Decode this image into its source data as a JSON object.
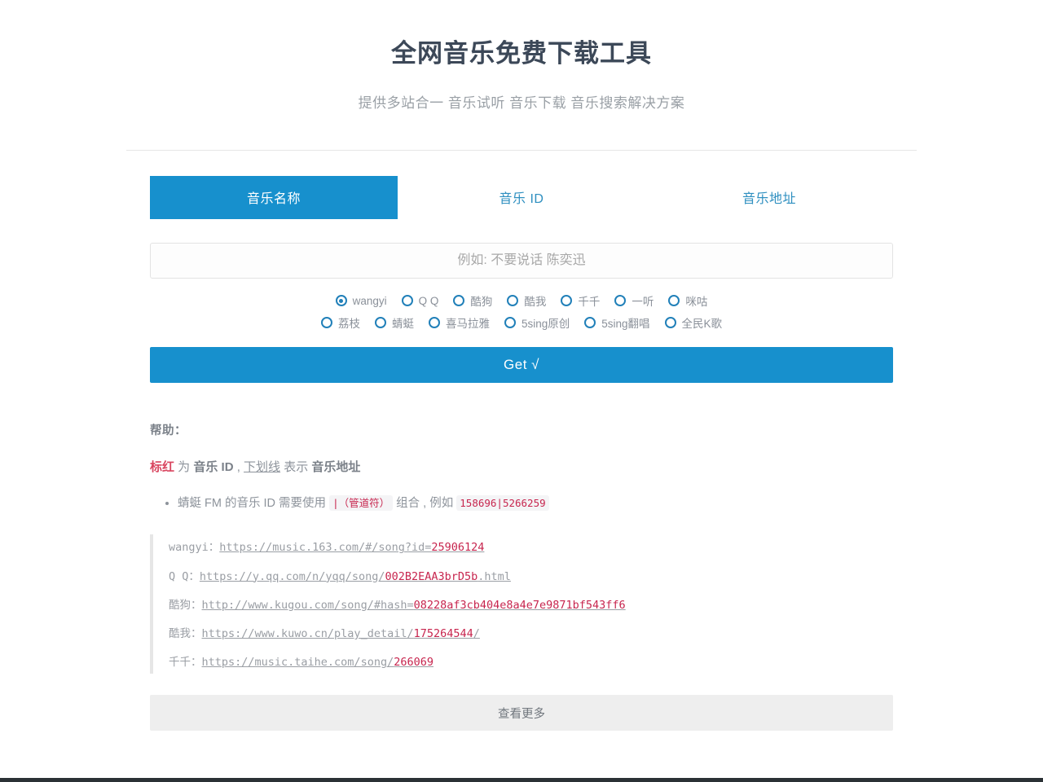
{
  "header": {
    "title": "全网音乐免费下载工具",
    "subtitle": "提供多站合一 音乐试听 音乐下载 音乐搜索解决方案"
  },
  "theme": {
    "accent": "#1790cd",
    "link": "#2e8fc0",
    "danger": "#c7254e",
    "muted": "#8d939b"
  },
  "tabs": [
    {
      "label": "音乐名称",
      "active": true
    },
    {
      "label": "音乐 ID",
      "active": false
    },
    {
      "label": "音乐地址",
      "active": false
    }
  ],
  "search": {
    "value": "",
    "placeholder": "例如: 不要说话 陈奕迅"
  },
  "sources": {
    "selected": "wangyi",
    "rows": [
      [
        {
          "label": "wangyi",
          "selected": true
        },
        {
          "label": "Q Q",
          "selected": false
        },
        {
          "label": "酷狗",
          "selected": false
        },
        {
          "label": "酷我",
          "selected": false
        },
        {
          "label": "千千",
          "selected": false
        },
        {
          "label": "一听",
          "selected": false
        },
        {
          "label": "咪咕",
          "selected": false
        }
      ],
      [
        {
          "label": "荔枝",
          "selected": false
        },
        {
          "label": "蜻蜓",
          "selected": false
        },
        {
          "label": "喜马拉雅",
          "selected": false
        },
        {
          "label": "5sing原创",
          "selected": false
        },
        {
          "label": "5sing翻唱",
          "selected": false
        },
        {
          "label": "全民K歌",
          "selected": false
        }
      ]
    ]
  },
  "submit": {
    "label": "Get √"
  },
  "help": {
    "title": "帮助：",
    "legend": {
      "red_text": "标红",
      "mid_1": " 为 ",
      "bold_1": "音乐 ID",
      "mid_2": " , ",
      "underline_text": "下划线",
      "mid_3": " 表示 ",
      "bold_2": "音乐地址"
    },
    "notes": [
      {
        "before": "蜻蜓 FM 的音乐 ID 需要使用 ",
        "code_1": "|（管道符）",
        "middle": " 组合 , 例如 ",
        "code_2": "158696|5266259"
      }
    ],
    "examples": [
      {
        "label": "wangyi：",
        "url": "https://music.163.com/#/song?id=",
        "id": "25906124",
        "tail": ""
      },
      {
        "label": "Q Q：",
        "url": "https://y.qq.com/n/yqq/song/",
        "id": "002B2EAA3brD5b",
        "tail": ".html"
      },
      {
        "label": "酷狗：",
        "url": "http://www.kugou.com/song/#hash=",
        "id": "08228af3cb404e8a4e7e9871bf543ff6",
        "tail": ""
      },
      {
        "label": "酷我：",
        "url": "https://www.kuwo.cn/play_detail/",
        "id": "175264544",
        "tail": "/"
      },
      {
        "label": "千千：",
        "url": "https://music.taihe.com/song/",
        "id": "266069",
        "tail": ""
      }
    ],
    "more_label": "查看更多"
  }
}
